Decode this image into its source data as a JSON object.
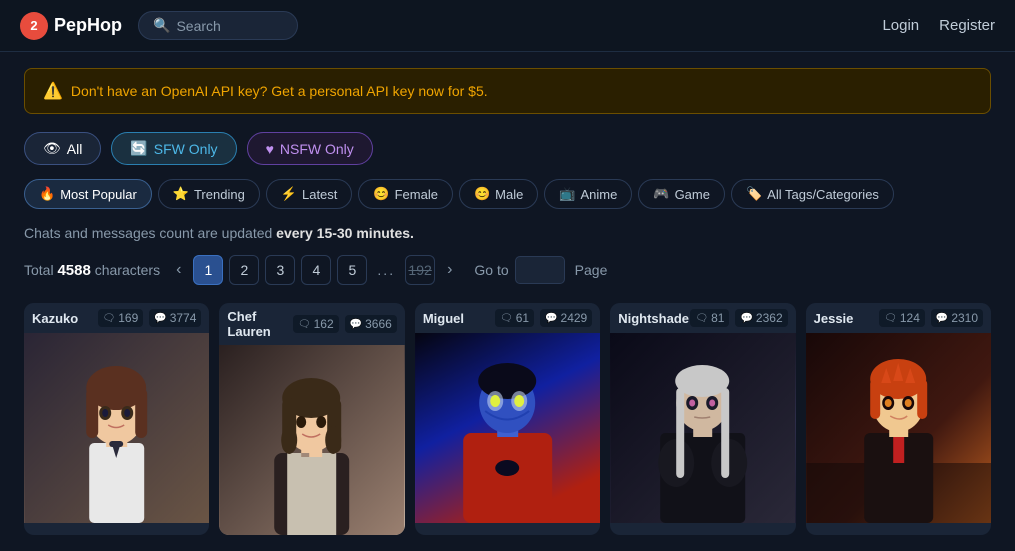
{
  "header": {
    "logo_number": "2",
    "logo_name": "PepHop",
    "search_placeholder": "Search",
    "nav": {
      "login": "Login",
      "register": "Register"
    }
  },
  "alert": {
    "icon": "⚠",
    "text": "Don't have an OpenAI API key? Get a personal API key now for $5."
  },
  "filters_row1": [
    {
      "id": "all",
      "icon": "👁",
      "label": "All",
      "active": true,
      "class": "active-all"
    },
    {
      "id": "sfw",
      "icon": "🔄",
      "label": "SFW Only",
      "active": false,
      "class": "active-sfw"
    },
    {
      "id": "nsfw",
      "icon": "♥",
      "label": "NSFW Only",
      "active": false,
      "class": "active-nsfw"
    }
  ],
  "filters_row2": [
    {
      "id": "popular",
      "icon": "🔥",
      "label": "Most Popular",
      "active": true
    },
    {
      "id": "trending",
      "icon": "⭐",
      "label": "Trending",
      "active": false
    },
    {
      "id": "latest",
      "icon": "⚡",
      "label": "Latest",
      "active": false
    },
    {
      "id": "female",
      "icon": "😊",
      "label": "Female",
      "active": false
    },
    {
      "id": "male",
      "icon": "😊",
      "label": "Male",
      "active": false
    },
    {
      "id": "anime",
      "icon": "📺",
      "label": "Anime",
      "active": false
    },
    {
      "id": "game",
      "icon": "🎮",
      "label": "Game",
      "active": false
    },
    {
      "id": "all-tags",
      "icon": "🏷",
      "label": "All Tags/Categories",
      "active": false
    }
  ],
  "info_text_pre": "Chats and messages count are updated ",
  "info_text_bold": "every 15-30 minutes.",
  "pagination": {
    "total_pre": "Total ",
    "total_number": "4588",
    "total_post": " characters",
    "pages": [
      "1",
      "2",
      "3",
      "4",
      "5"
    ],
    "dots": "...",
    "last_page": "192",
    "goto_label": "Go to",
    "page_label": "Page"
  },
  "characters": [
    {
      "name": "Kazuko",
      "chats": "169",
      "messages": "3774",
      "theme": "kazuko",
      "hair_color": "#5a3a2a",
      "skin_color": "#f0d0b0",
      "outfit_color": "#e8e8e8"
    },
    {
      "name": "Chef Lauren",
      "chats": "162",
      "messages": "3666",
      "theme": "chef",
      "hair_color": "#3a2a1a",
      "skin_color": "#f0d0b0",
      "outfit_color": "#2a2a2a"
    },
    {
      "name": "Miguel",
      "chats": "61",
      "messages": "2429",
      "theme": "miguel",
      "hair_color": "#1a1a2a",
      "skin_color": "#3060c0",
      "outfit_color": "#c03020"
    },
    {
      "name": "Nightshade",
      "chats": "81",
      "messages": "2362",
      "theme": "nightshade",
      "hair_color": "#c0c0c0",
      "skin_color": "#c0b0a0",
      "outfit_color": "#1a1a2a"
    },
    {
      "name": "Jessie",
      "chats": "124",
      "messages": "2310",
      "theme": "jessie",
      "hair_color": "#c04020",
      "skin_color": "#f0c8a0",
      "outfit_color": "#1a1a1a"
    }
  ],
  "icons": {
    "chat": "💬",
    "message": "💬",
    "chat_icon": "🗨",
    "search_icon": "🔍"
  }
}
